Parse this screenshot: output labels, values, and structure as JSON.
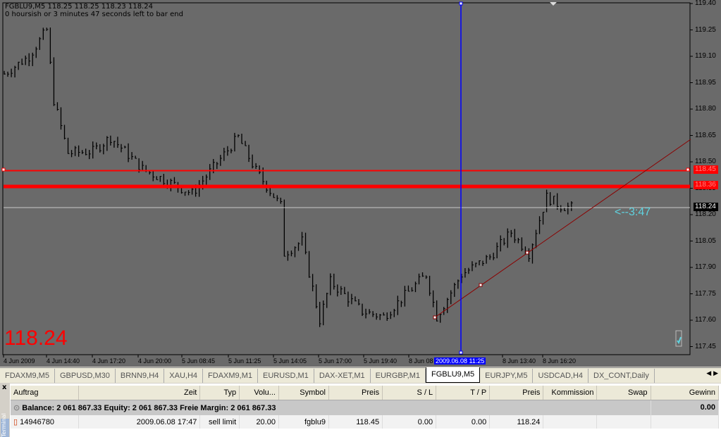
{
  "chart": {
    "header_line1": "FGBLU9,M5  118.25 118.25 118.23 118.24",
    "header_line2": "0 hoursish or 3 minutes 47 seconds left to bar end",
    "big_price": "118.24",
    "countdown": "<--3:47",
    "y_ticks": [
      "119.40",
      "119.25",
      "119.10",
      "118.95",
      "118.80",
      "118.65",
      "118.50",
      "118.35",
      "118.20",
      "118.05",
      "117.90",
      "117.75",
      "117.60",
      "117.45"
    ],
    "price_labels": {
      "line1": "118.45",
      "line2": "118.36",
      "current": "118.24"
    },
    "x_ticks": [
      "4 Jun 2009",
      "4 Jun 14:40",
      "4 Jun 17:20",
      "4 Jun 20:00",
      "5 Jun 08:45",
      "5 Jun 11:25",
      "5 Jun 14:05",
      "5 Jun 17:00",
      "5 Jun 19:40",
      "8 Jun 08",
      "8 Jun 13:40",
      "8 Jun 16:20"
    ],
    "cursor_time": "2009.06.08 11:25",
    "colors": {
      "bg": "#6a6a6a",
      "bars": "#000000",
      "hline": "#ff0000",
      "vline": "#0000ff",
      "trend": "#8b0000"
    }
  },
  "chart_data": {
    "type": "line",
    "symbol": "FGBLU9,M5",
    "ylim": [
      117.45,
      119.4
    ],
    "hlines": [
      118.45,
      118.36,
      118.24
    ],
    "keypoints_bar_price": [
      [
        0,
        119.0
      ],
      [
        7,
        119.1
      ],
      [
        12,
        119.25
      ],
      [
        14,
        118.85
      ],
      [
        18,
        118.55
      ],
      [
        25,
        118.56
      ],
      [
        30,
        118.64
      ],
      [
        39,
        118.46
      ],
      [
        53,
        118.32
      ],
      [
        66,
        118.64
      ],
      [
        71,
        118.45
      ],
      [
        78,
        118.25
      ],
      [
        79,
        117.98
      ],
      [
        84,
        118.05
      ],
      [
        89,
        117.6
      ],
      [
        92,
        117.82
      ],
      [
        101,
        117.65
      ],
      [
        107,
        117.62
      ],
      [
        114,
        117.76
      ],
      [
        119,
        117.86
      ],
      [
        122,
        117.62
      ],
      [
        129,
        117.86
      ],
      [
        137,
        117.96
      ],
      [
        143,
        118.1
      ],
      [
        148,
        117.98
      ],
      [
        153,
        118.3
      ],
      [
        157,
        118.25
      ],
      [
        160,
        118.24
      ]
    ]
  },
  "tabs": [
    "FDAXM9,M5",
    "GBPUSD,M30",
    "BRNN9,H4",
    "XAU,H4",
    "FDAXM9,M1",
    "EURUSD,M1",
    "DAX-XET,M1",
    "EURGBP,M1",
    "FGBLU9,M5",
    "EURJPY,M5",
    "USDCAD,H4",
    "DX_CONT,Daily"
  ],
  "active_tab": 8,
  "terminal": {
    "close": "x",
    "side_label": "Terminal",
    "columns": [
      "Auftrag",
      "Zeit",
      "Typ",
      "Volu...",
      "Symbol",
      "Preis",
      "S / L",
      "T / P",
      "Preis",
      "Kommission",
      "Swap",
      "Gewinn"
    ],
    "balance": "Balance: 2 061 867.33  Equity: 2 061 867.33  Freie Margin: 2 061 867.33",
    "balance_profit": "0.00",
    "orders": [
      [
        "14946780",
        "2009.06.08 17:47",
        "sell limit",
        "20.00",
        "fgblu9",
        "118.45",
        "0.00",
        "0.00",
        "118.24",
        "",
        "",
        ""
      ]
    ]
  }
}
